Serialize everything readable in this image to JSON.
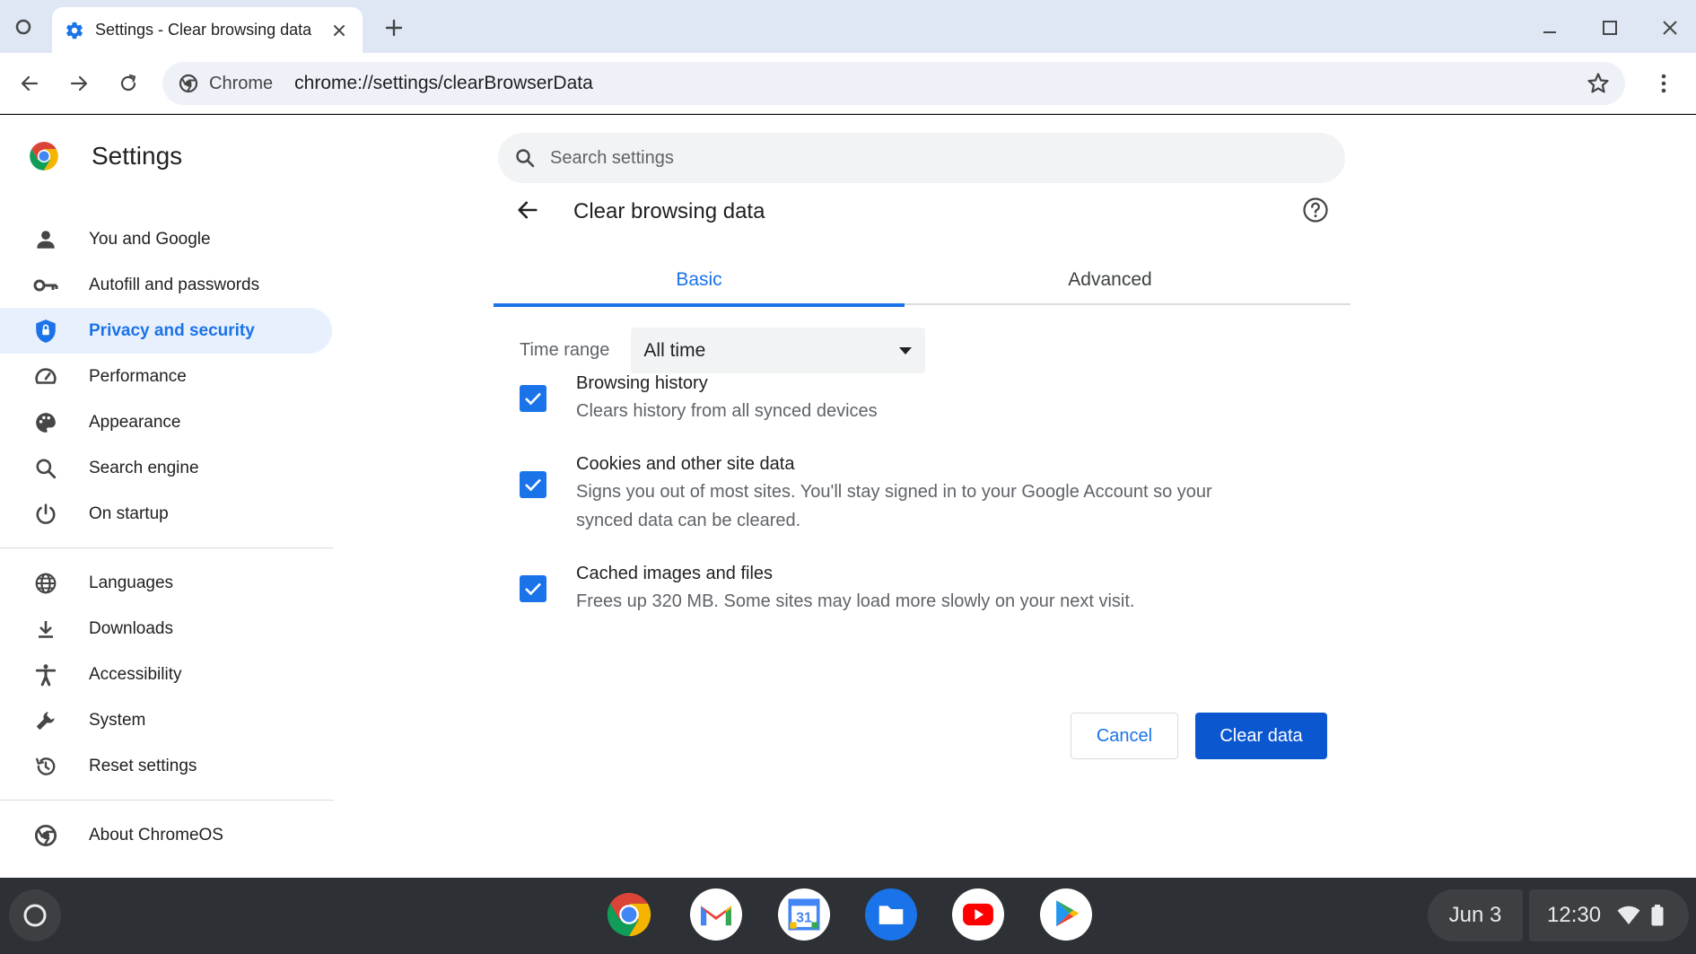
{
  "browser": {
    "tab_title": "Settings - Clear browsing data",
    "site_chip": "Chrome",
    "url": "chrome://settings/clearBrowserData"
  },
  "settings": {
    "title": "Settings",
    "search_placeholder": "Search settings"
  },
  "sidebar": {
    "items": [
      {
        "label": "You and Google",
        "icon": "person-icon"
      },
      {
        "label": "Autofill and passwords",
        "icon": "key-icon"
      },
      {
        "label": "Privacy and security",
        "icon": "shield-icon",
        "active": true
      },
      {
        "label": "Performance",
        "icon": "speedometer-icon"
      },
      {
        "label": "Appearance",
        "icon": "palette-icon"
      },
      {
        "label": "Search engine",
        "icon": "search-icon"
      },
      {
        "label": "On startup",
        "icon": "power-icon"
      }
    ],
    "items2": [
      {
        "label": "Languages",
        "icon": "globe-icon"
      },
      {
        "label": "Downloads",
        "icon": "download-icon"
      },
      {
        "label": "Accessibility",
        "icon": "accessibility-icon"
      },
      {
        "label": "System",
        "icon": "wrench-icon"
      },
      {
        "label": "Reset settings",
        "icon": "history-icon"
      }
    ],
    "items3": [
      {
        "label": "About ChromeOS",
        "icon": "chromeos-icon"
      }
    ]
  },
  "dialog": {
    "title": "Clear browsing data",
    "tabs": [
      "Basic",
      "Advanced"
    ],
    "active_tab": "Basic",
    "time_range_label": "Time range",
    "time_range_value": "All time",
    "options": [
      {
        "title": "Browsing history",
        "desc": "Clears history from all synced devices",
        "checked": true
      },
      {
        "title": "Cookies and other site data",
        "desc": "Signs you out of most sites. You'll stay signed in to your Google Account so your synced data can be cleared.",
        "checked": true
      },
      {
        "title": "Cached images and files",
        "desc": "Frees up 320 MB. Some sites may load more slowly on your next visit.",
        "checked": true
      }
    ],
    "cancel_label": "Cancel",
    "clear_label": "Clear data"
  },
  "shelf": {
    "apps": [
      "Chrome",
      "Gmail",
      "Calendar",
      "Files",
      "YouTube",
      "Play Store"
    ],
    "calendar_day": "31",
    "date": "Jun 3",
    "time": "12:30"
  },
  "colors": {
    "accent": "#1a73e8",
    "active_bg": "#e8f0fe",
    "primary_button": "#0b57d0",
    "shelf": "#2d3135"
  }
}
